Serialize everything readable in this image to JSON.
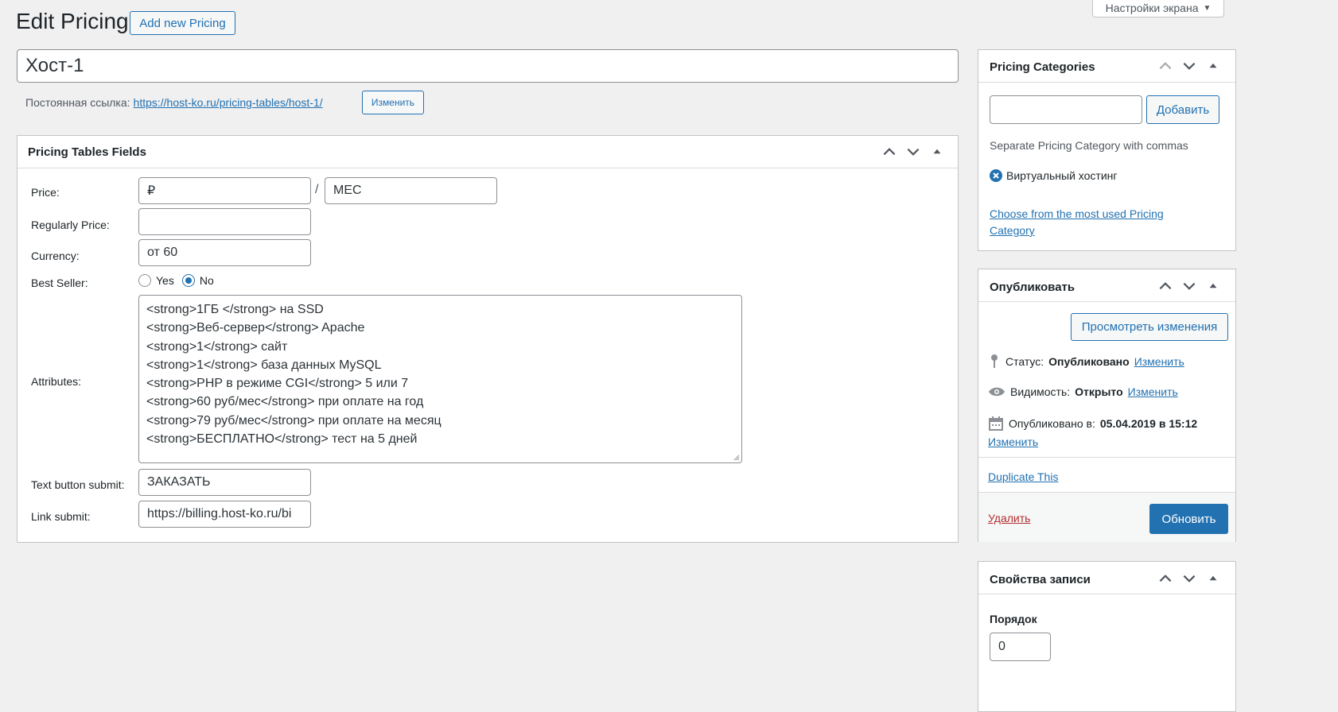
{
  "header": {
    "title": "Edit Pricing",
    "add_new_label": "Add new Pricing",
    "screen_options_label": "Настройки экрана"
  },
  "post": {
    "title_value": "Хост-1",
    "permalink_label": "Постоянная ссылка:",
    "permalink_url": "https://host-ko.ru/pricing-tables/host-1/",
    "permalink_edit_label": "Изменить"
  },
  "fields_box": {
    "title": "Pricing Tables Fields",
    "price_label": "Price:",
    "price_value": "₽",
    "price_separator": "/",
    "period_value": "МЕС",
    "regular_price_label": "Regularly Price:",
    "regular_price_value": "",
    "currency_label": "Currency:",
    "currency_value": "от 60",
    "best_seller_label": "Best Seller:",
    "best_seller_yes": "Yes",
    "best_seller_no": "No",
    "best_seller_selected": "No",
    "attributes_label": "Attributes:",
    "attributes_lines": [
      "<strong>1ГБ </strong> на SSD",
      "<strong>Веб-сервер</strong> Apache",
      "<strong>1</strong> сайт",
      "<strong>1</strong> база данных MySQL",
      "<strong>PHP в режиме CGI</strong> 5 или 7",
      "<strong>60 руб/мес</strong>  при оплате на год",
      "<strong>79 руб/мес</strong>  при оплате на месяц",
      "<strong>БЕСПЛАТНО</strong> тест на 5 дней"
    ],
    "text_button_label": "Text button submit:",
    "text_button_value": "ЗАКАЗАТЬ",
    "link_submit_label": "Link submit:",
    "link_submit_value": "https://billing.host-ko.ru/bi"
  },
  "categories_box": {
    "title": "Pricing Categories",
    "add_input_value": "",
    "add_button_label": "Добавить",
    "hint": "Separate Pricing Category with commas",
    "tag": "Виртуальный хостинг",
    "most_used_link": "Choose from the most used Pricing Category"
  },
  "publish_box": {
    "title": "Опубликовать",
    "preview_button": "Просмотреть изменения",
    "status_label": "Статус:",
    "status_value": "Опубликовано",
    "status_edit": "Изменить",
    "visibility_label": "Видимость:",
    "visibility_value": "Открыто",
    "visibility_edit": "Изменить",
    "published_label": "Опубликовано в:",
    "published_value": "05.04.2019 в 15:12",
    "published_edit": "Изменить",
    "duplicate_link": "Duplicate This",
    "delete_link": "Удалить",
    "update_button": "Обновить"
  },
  "attributes_box": {
    "title": "Свойства записи",
    "order_label": "Порядок",
    "order_value": "0"
  },
  "colors": {
    "accent": "#2271b1",
    "primary_button": "#2271b1",
    "delete": "#b32d2e",
    "background": "#f0f0f1"
  }
}
